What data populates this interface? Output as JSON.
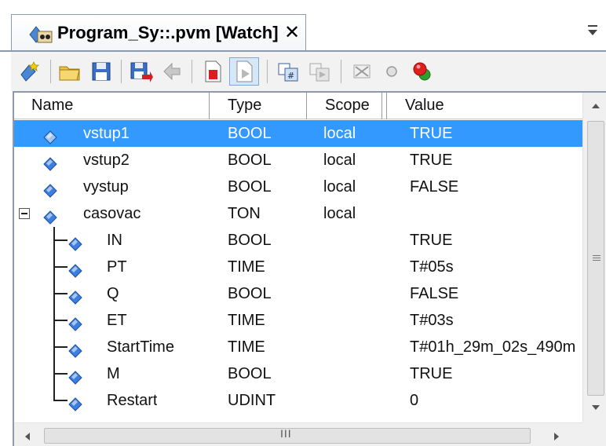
{
  "tab": {
    "title": "Program_Sy::.pvm [Watch]",
    "close_glyph": "✕",
    "icon": "watch-program-icon",
    "menu_icon": "tab-list-dropdown-icon"
  },
  "toolbar": {
    "buttons": [
      {
        "icon": "add-variable-icon"
      },
      {
        "icon": "open-folder-icon"
      },
      {
        "icon": "save-icon"
      },
      {
        "icon": "save-as-icon"
      },
      {
        "icon": "back-arrow-icon"
      },
      {
        "icon": "stop-icon"
      },
      {
        "icon": "run-icon"
      },
      {
        "icon": "format-hex-icon"
      },
      {
        "icon": "format-copy-icon"
      },
      {
        "icon": "remove-icon"
      },
      {
        "icon": "breakpoint-icon"
      },
      {
        "icon": "force-red-icon"
      }
    ]
  },
  "columns": {
    "name": "Name",
    "type": "Type",
    "scope": "Scope",
    "value": "Value"
  },
  "rows": [
    {
      "name": "vstup1",
      "type": "BOOL",
      "scope": "local",
      "value": "TRUE",
      "selected": true
    },
    {
      "name": "vstup2",
      "type": "BOOL",
      "scope": "local",
      "value": "TRUE"
    },
    {
      "name": "vystup",
      "type": "BOOL",
      "scope": "local",
      "value": "FALSE"
    },
    {
      "name": "casovac",
      "type": "TON",
      "scope": "local",
      "value": "",
      "expanded": true
    },
    {
      "name": "IN",
      "type": "BOOL",
      "scope": "",
      "value": "TRUE",
      "child": true
    },
    {
      "name": "PT",
      "type": "TIME",
      "scope": "",
      "value": "T#05s",
      "child": true
    },
    {
      "name": "Q",
      "type": "BOOL",
      "scope": "",
      "value": "FALSE",
      "child": true
    },
    {
      "name": "ET",
      "type": "TIME",
      "scope": "",
      "value": "T#03s",
      "child": true
    },
    {
      "name": "StartTime",
      "type": "TIME",
      "scope": "",
      "value": "T#01h_29m_02s_490m",
      "child": true
    },
    {
      "name": "M",
      "type": "BOOL",
      "scope": "",
      "value": "TRUE",
      "child": true
    },
    {
      "name": "Restart",
      "type": "UDINT",
      "scope": "",
      "value": "0",
      "child": true,
      "last": true
    }
  ],
  "scrollbar": {
    "h_grip": "III"
  },
  "colors": {
    "selection": "#3399ff",
    "diamond": "#3d7fe0",
    "border": "#8c9aaa"
  }
}
